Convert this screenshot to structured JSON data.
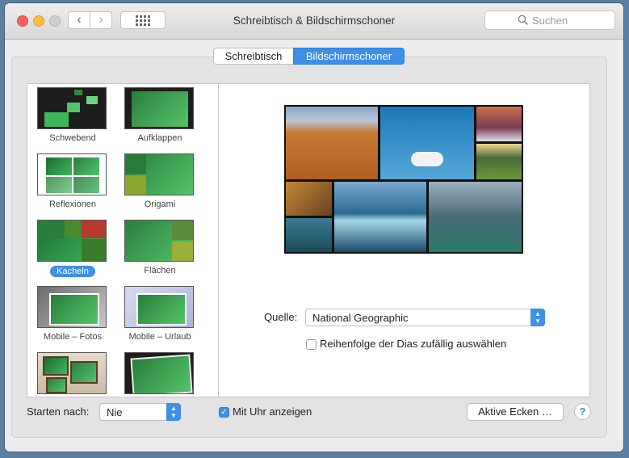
{
  "window": {
    "title": "Schreibtisch & Bildschirmschoner"
  },
  "toolbar": {
    "back_icon": "chevron-left-icon",
    "forward_icon": "chevron-right-icon",
    "grid_icon": "grid-icon",
    "search_placeholder": "Suchen"
  },
  "tabs": [
    {
      "label": "Schreibtisch",
      "selected": false
    },
    {
      "label": "Bildschirmschoner",
      "selected": true
    }
  ],
  "screensavers": [
    {
      "label": "Schwebend",
      "selected": false
    },
    {
      "label": "Aufklappen",
      "selected": false
    },
    {
      "label": "Reflexionen",
      "selected": false
    },
    {
      "label": "Origami",
      "selected": false
    },
    {
      "label": "Kacheln",
      "selected": true
    },
    {
      "label": "Flächen",
      "selected": false
    },
    {
      "label": "Mobile – Fotos",
      "selected": false
    },
    {
      "label": "Mobile – Urlaub",
      "selected": false
    },
    {
      "label": "",
      "selected": false
    },
    {
      "label": "",
      "selected": false
    }
  ],
  "options": {
    "source_label": "Quelle:",
    "source_value": "National Geographic",
    "shuffle_label": "Reihenfolge der Dias zufällig auswählen",
    "shuffle_checked": false
  },
  "footer": {
    "start_after_label": "Starten nach:",
    "start_after_value": "Nie",
    "show_clock_label": "Mit Uhr anzeigen",
    "show_clock_checked": true,
    "hot_corners_label": "Aktive Ecken …",
    "help_label": "?"
  },
  "colors": {
    "accent": "#3d8fe8"
  }
}
